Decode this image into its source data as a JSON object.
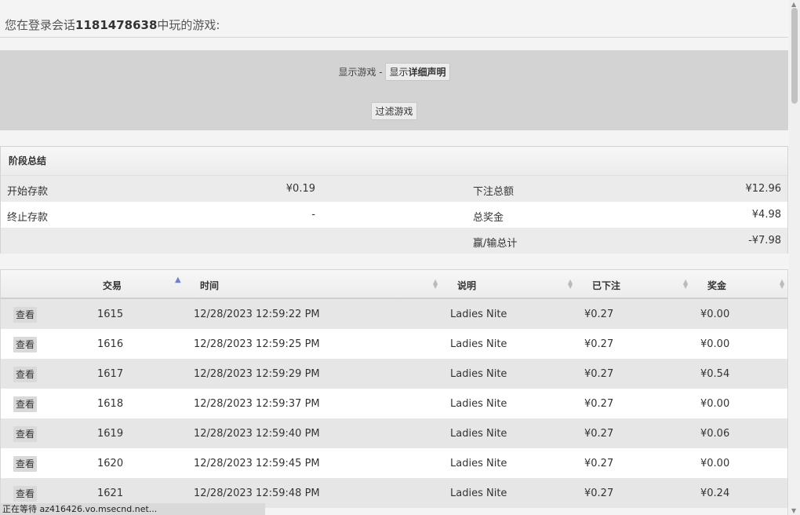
{
  "header": {
    "prefix": "您在登录会话",
    "session_id": "1181478638",
    "suffix": "中玩的游戏:"
  },
  "filter": {
    "show_label": "显示游戏 -",
    "show_button_prefix": "显示",
    "show_button_bold": "详细声明",
    "filter_button": "过滤游戏"
  },
  "summary": {
    "title": "阶段总结",
    "rows": [
      {
        "label1": "开始存款",
        "value1": "¥0.19",
        "label2": "下注总额",
        "value2": "¥12.96"
      },
      {
        "label1": "终止存款",
        "value1": "-",
        "label2": "总奖金",
        "value2": "¥4.98"
      },
      {
        "label1": "",
        "value1": "",
        "label2": "赢/输总计",
        "value2": "-¥7.98"
      }
    ]
  },
  "games_table": {
    "columns": {
      "transaction": "交易",
      "time": "时间",
      "description": "说明",
      "bet": "已下注",
      "win": "奖金"
    },
    "view_label": "查看",
    "rows": [
      {
        "id": "1615",
        "time": "12/28/2023 12:59:22 PM",
        "desc": "Ladies Nite",
        "bet": "¥0.27",
        "win": "¥0.00"
      },
      {
        "id": "1616",
        "time": "12/28/2023 12:59:25 PM",
        "desc": "Ladies Nite",
        "bet": "¥0.27",
        "win": "¥0.00"
      },
      {
        "id": "1617",
        "time": "12/28/2023 12:59:29 PM",
        "desc": "Ladies Nite",
        "bet": "¥0.27",
        "win": "¥0.54"
      },
      {
        "id": "1618",
        "time": "12/28/2023 12:59:37 PM",
        "desc": "Ladies Nite",
        "bet": "¥0.27",
        "win": "¥0.00"
      },
      {
        "id": "1619",
        "time": "12/28/2023 12:59:40 PM",
        "desc": "Ladies Nite",
        "bet": "¥0.27",
        "win": "¥0.06"
      },
      {
        "id": "1620",
        "time": "12/28/2023 12:59:45 PM",
        "desc": "Ladies Nite",
        "bet": "¥0.27",
        "win": "¥0.00"
      },
      {
        "id": "1621",
        "time": "12/28/2023 12:59:48 PM",
        "desc": "Ladies Nite",
        "bet": "¥0.27",
        "win": "¥0.24"
      }
    ]
  },
  "status_bar": {
    "text": "正在等待 az416426.vo.msecnd.net..."
  },
  "colors": {
    "panel_gray": "#d3d3d3",
    "row_alt": "#e6e6e6",
    "sort_active": "#6d7fd6"
  }
}
